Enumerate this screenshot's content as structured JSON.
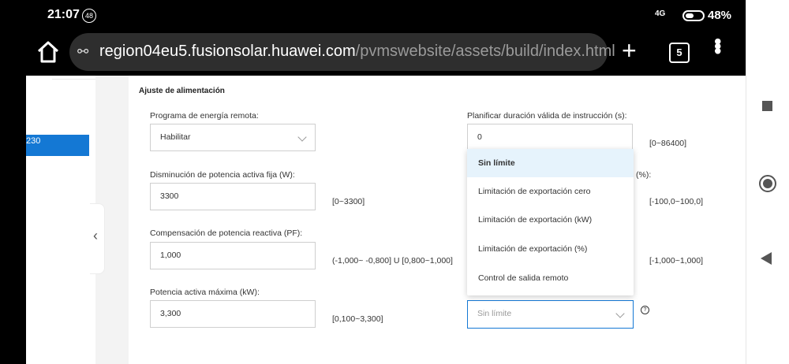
{
  "status": {
    "time": "21:07",
    "notif_count": "48",
    "network": "4G",
    "battery": "48%"
  },
  "browser": {
    "url_domain": "region04eu5.fusionsolar.huawei.com",
    "url_path": "/pvmswebsite/assets/build/index.html",
    "tab_count": "5"
  },
  "sidebar": {
    "selected_item": "230"
  },
  "section": {
    "title": "Ajuste de alimentación"
  },
  "fields": {
    "remote_program": {
      "label": "Programa de energía remota:",
      "value": "Habilitar"
    },
    "schedule_duration": {
      "label": "Planificar duración válida de instrucción (s):",
      "value": "0",
      "range": "[0~86400]"
    },
    "active_power_reduction": {
      "label": "Disminución de potencia activa fija (W):",
      "value": "3300",
      "range": "[0~3300]"
    },
    "reactive_compensation": {
      "label": "Compensación de potencia reactiva (PF):",
      "value": "1,000",
      "range": "(-1,000~ -0,800] U [0,800~1,000]"
    },
    "max_active_power": {
      "label": "Potencia activa máxima (kW):",
      "value": "3,300",
      "range": "[0,100~3,300]"
    },
    "export_limit": {
      "value": "Sin límite"
    }
  },
  "right_column": {
    "pct_suffix": "(%):",
    "range_1": "[-100,0~100,0]",
    "range_2": "[-1,000~1,000]"
  },
  "dropdown": {
    "options": [
      "Sin límite",
      "Limitación de exportación cero",
      "Limitación de exportación (kW)",
      "Limitación de exportación (%)",
      "Control de salida remoto"
    ]
  },
  "help": {
    "glyph": "?"
  }
}
